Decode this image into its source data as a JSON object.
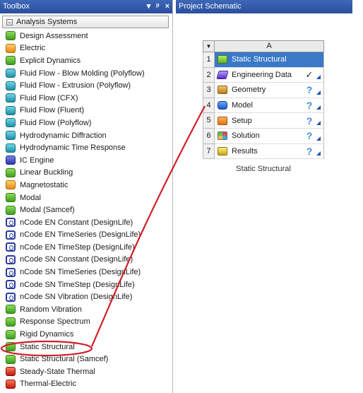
{
  "toolbox": {
    "title": "Toolbox",
    "controls": {
      "pin": "▾",
      "autohide": "ᵖ",
      "close": "×"
    },
    "group_label": "Analysis Systems",
    "group_toggle": "−",
    "items": [
      {
        "label": "Design Assessment",
        "icon": "green"
      },
      {
        "label": "Electric",
        "icon": "orange"
      },
      {
        "label": "Explicit Dynamics",
        "icon": "green"
      },
      {
        "label": "Fluid Flow - Blow Molding (Polyflow)",
        "icon": "teal"
      },
      {
        "label": "Fluid Flow - Extrusion (Polyflow)",
        "icon": "teal"
      },
      {
        "label": "Fluid Flow (CFX)",
        "icon": "teal"
      },
      {
        "label": "Fluid Flow (Fluent)",
        "icon": "teal"
      },
      {
        "label": "Fluid Flow (Polyflow)",
        "icon": "teal"
      },
      {
        "label": "Hydrodynamic Diffraction",
        "icon": "teal"
      },
      {
        "label": "Hydrodynamic Time Response",
        "icon": "teal"
      },
      {
        "label": "IC Engine",
        "icon": "blue"
      },
      {
        "label": "Linear Buckling",
        "icon": "green"
      },
      {
        "label": "Magnetostatic",
        "icon": "orange"
      },
      {
        "label": "Modal",
        "icon": "green"
      },
      {
        "label": "Modal (Samcef)",
        "icon": "green"
      },
      {
        "label": "nCode EN Constant (DesignLife)",
        "icon": "ncode"
      },
      {
        "label": "nCode EN TimeSeries (DesignLife)",
        "icon": "ncode"
      },
      {
        "label": "nCode EN TimeStep (DesignLife)",
        "icon": "ncode"
      },
      {
        "label": "nCode SN Constant (DesignLife)",
        "icon": "ncode"
      },
      {
        "label": "nCode SN TimeSeries (DesignLife)",
        "icon": "ncode"
      },
      {
        "label": "nCode SN TimeStep (DesignLife)",
        "icon": "ncode"
      },
      {
        "label": "nCode SN Vibration (DesignLife)",
        "icon": "ncode"
      },
      {
        "label": "Random Vibration",
        "icon": "green"
      },
      {
        "label": "Response Spectrum",
        "icon": "green"
      },
      {
        "label": "Rigid Dynamics",
        "icon": "green"
      },
      {
        "label": "Static Structural",
        "icon": "green"
      },
      {
        "label": "Static Structural (Samcef)",
        "icon": "green"
      },
      {
        "label": "Steady-State Thermal",
        "icon": "red"
      },
      {
        "label": "Thermal-Electric",
        "icon": "red"
      }
    ]
  },
  "schematic": {
    "title": "Project Schematic",
    "block": {
      "column": "A",
      "rows": [
        {
          "num": "1",
          "label": "Static Structural",
          "icon": "green",
          "status": "",
          "title": true
        },
        {
          "num": "2",
          "label": "Engineering Data",
          "icon": "purple",
          "status": "✓"
        },
        {
          "num": "3",
          "label": "Geometry",
          "icon": "tan",
          "status": "?"
        },
        {
          "num": "4",
          "label": "Model",
          "icon": "blue",
          "status": "?"
        },
        {
          "num": "5",
          "label": "Setup",
          "icon": "orange",
          "status": "?"
        },
        {
          "num": "6",
          "label": "Solution",
          "icon": "multi",
          "status": "?"
        },
        {
          "num": "7",
          "label": "Results",
          "icon": "yellow",
          "status": "?"
        }
      ],
      "caption": "Static Structural"
    }
  },
  "colors": {
    "titlebar": "#2b4f9c",
    "selected_cell": "#3a78c8",
    "annotation": "#d0202a"
  }
}
